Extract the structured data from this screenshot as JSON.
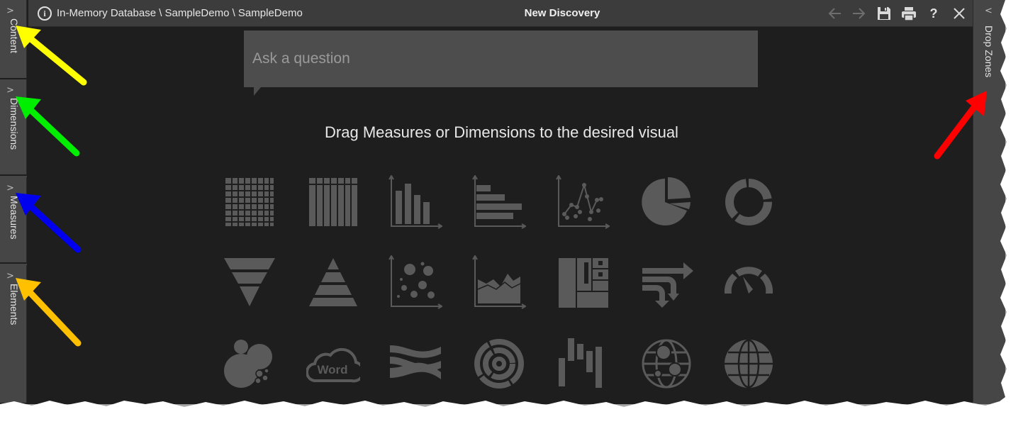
{
  "left_tabs": [
    {
      "label": "Content",
      "icon": "chevron-right-icon"
    },
    {
      "label": "Dimensions",
      "icon": "chevron-right-icon"
    },
    {
      "label": "Measures",
      "icon": "chevron-right-icon"
    },
    {
      "label": "Elements",
      "icon": "chevron-right-icon"
    }
  ],
  "right_tab": {
    "label": "Drop Zones",
    "icon": "chevron-left-icon"
  },
  "titlebar": {
    "breadcrumb": "In-Memory Database \\ SampleDemo \\ SampleDemo",
    "title": "New Discovery",
    "buttons": [
      "back-arrow-icon",
      "forward-arrow-icon",
      "save-icon",
      "print-icon",
      "help-icon",
      "close-icon"
    ],
    "help_glyph": "?"
  },
  "ask": {
    "placeholder": "Ask a question",
    "value": ""
  },
  "hint": "Drag Measures or Dimensions to the desired visual",
  "visual_gallery": [
    [
      "grid-table-icon",
      "pivot-columns-icon",
      "column-chart-icon",
      "bar-chart-icon",
      "scatter-line-icon",
      "pie-chart-icon",
      "donut-chart-icon"
    ],
    [
      "funnel-icon",
      "pyramid-icon",
      "bubble-chart-icon",
      "area-chart-icon",
      "treemap-icon",
      "flow-icon",
      "gauge-icon"
    ],
    [
      "packed-bubble-icon",
      "word-cloud-icon",
      "sankey-icon",
      "sunburst-icon",
      "waterfall-icon",
      "bubble-map-icon",
      "globe-map-icon"
    ]
  ],
  "word_cloud_text": "Word",
  "colors": {
    "frame_bg": "#1e1e1e",
    "rail_bg": "#464646",
    "titlebar_bg": "#3c3c3c",
    "icon_gray": "#5a5a5a",
    "arrow_yellow": "#ffff00",
    "arrow_green": "#00ee00",
    "arrow_blue": "#0000ee",
    "arrow_orange": "#ffc000",
    "arrow_red": "#ff0000"
  }
}
